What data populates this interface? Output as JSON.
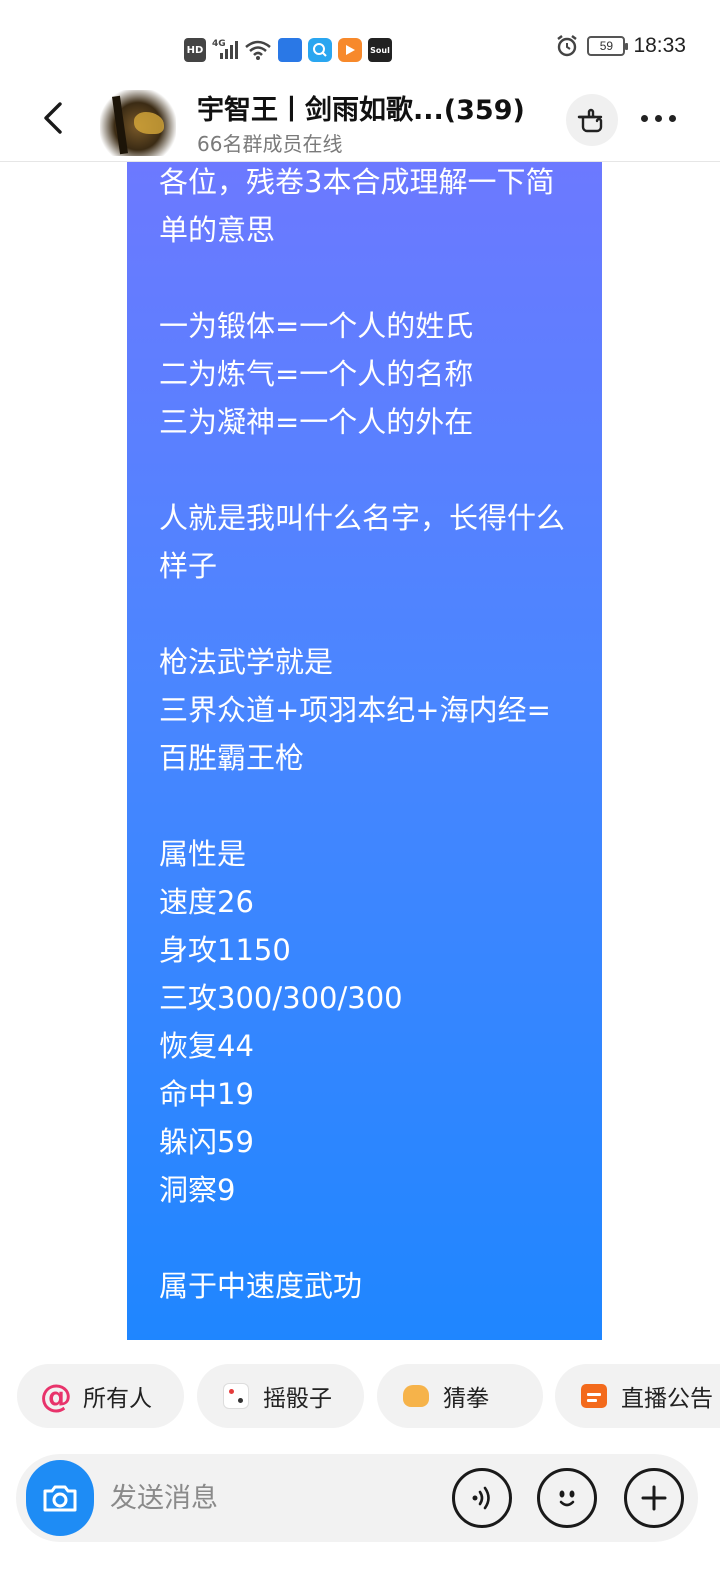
{
  "status_bar": {
    "time": "18:33",
    "battery": "59",
    "network": "4G",
    "hd": "HD",
    "app_icons": [
      "app-store-icon",
      "browser-icon",
      "video-icon",
      "soul-icon"
    ],
    "soul_label": "Soul"
  },
  "header": {
    "title": "宇智王丨剑雨如歌...",
    "member_count": "(359)",
    "subtitle": "66名群成员在线"
  },
  "message": {
    "text": "各位，残卷3本合成理解一下简单的意思\n\n一为锻体=一个人的姓氏\n二为炼气=一个人的名称\n三为凝神=一个人的外在\n\n人就是我叫什么名字，长得什么样子\n\n枪法武学就是\n三界众道+项羽本纪+海内经=百胜霸王枪\n\n属性是\n速度26\n身攻1150\n三攻300/300/300\n恢复44\n命中19\n躲闪59\n洞察9\n\n属于中速度武功"
  },
  "quick_actions": [
    {
      "label": "所有人",
      "icon": "at-icon"
    },
    {
      "label": "摇骰子",
      "icon": "dice-icon"
    },
    {
      "label": "猜拳",
      "icon": "rock-paper-scissors-icon"
    },
    {
      "label": "直播公告",
      "icon": "live-announcement-icon"
    }
  ],
  "input_bar": {
    "placeholder": "发送消息"
  },
  "colors": {
    "bubble_top": "#6c79ff",
    "bubble_bottom": "#1f86ff",
    "camera": "#1e8cf5",
    "at_accent": "#e8336b"
  }
}
